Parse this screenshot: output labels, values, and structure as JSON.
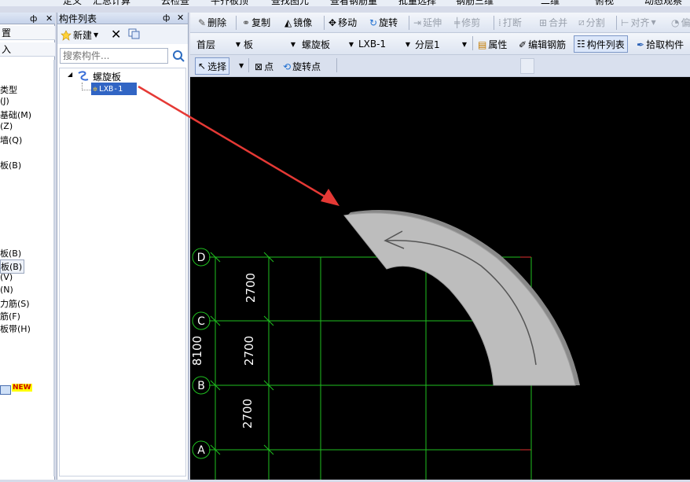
{
  "top_menu": {
    "items": [
      "定义",
      "汇总计算",
      "云检查",
      "平齐板顶",
      "查找图元",
      "查看钢筋量",
      "批量选择",
      "钢筋三维",
      "二维",
      "俯视",
      "动态观察"
    ]
  },
  "left_panel": {
    "title_btns": [
      "ф",
      "✕"
    ],
    "rows": [
      "置",
      "入"
    ],
    "tree_items": [
      "类型",
      "(J)",
      "基础(M)",
      "(Z)",
      "墙(Q)",
      "板(B)",
      "板(B)",
      "板(B)",
      "(V)",
      "(N)",
      "力筋(S)",
      "筋(F)",
      "板带(H)"
    ],
    "badge": "NEW"
  },
  "component_panel": {
    "title": "构件列表",
    "pin": "ф",
    "close": "✕",
    "new_label": "新建",
    "search_placeholder": "搜索构件...",
    "tree_root": "螺旋板",
    "tree_child": "LXB-1"
  },
  "toolbar1": {
    "items": [
      "删除",
      "复制",
      "镜像",
      "移动",
      "旋转",
      "延伸",
      "修剪",
      "打断",
      "合并",
      "分割",
      "对齐",
      "偏"
    ]
  },
  "toolbar2": {
    "floor": "首层",
    "category": "板",
    "type": "螺旋板",
    "component": "LXB-1",
    "layer": "分层1",
    "props_label": "属性",
    "edit_rebar_label": "编辑钢筋",
    "comp_list_label": "构件列表",
    "pick_label": "拾取构件"
  },
  "toolbar3": {
    "select_label": "选择",
    "point_label": "点",
    "rotate_point_label": "旋转点"
  },
  "drawing": {
    "axes": [
      "D",
      "C",
      "B",
      "A"
    ],
    "dims": [
      "2700",
      "2700",
      "2700"
    ],
    "total_dim": "8100",
    "colors": {
      "grid_green": "#1fbf1f",
      "grid_red": "#e03030",
      "slab": "#bdbdbd",
      "arrow": "#e53935"
    }
  }
}
